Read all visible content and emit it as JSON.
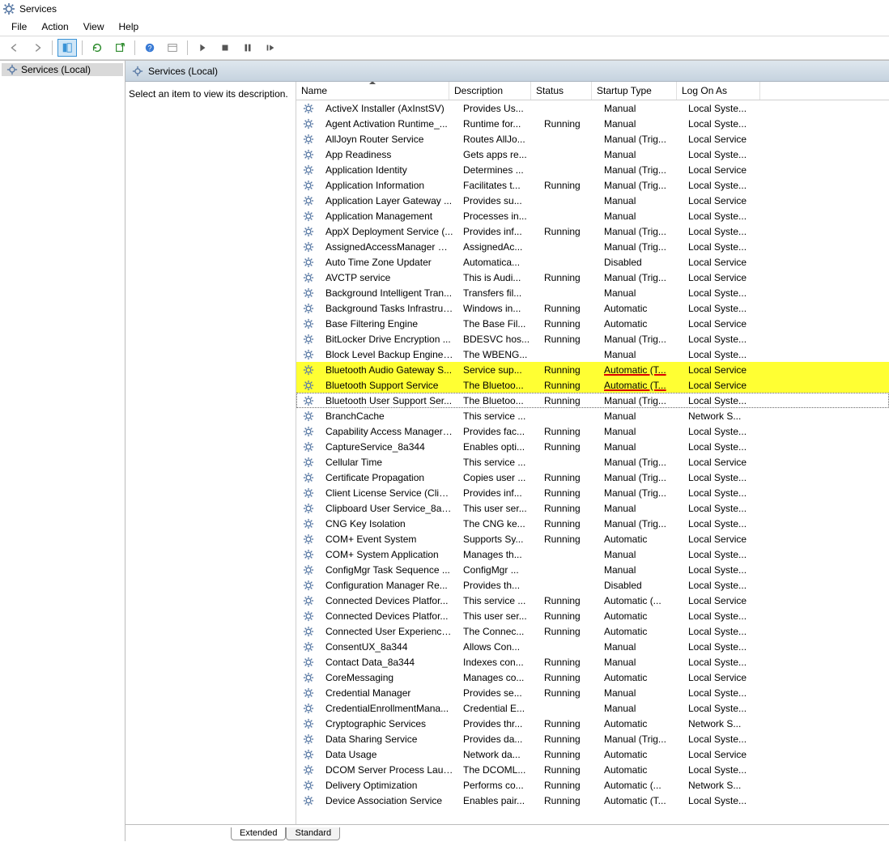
{
  "window": {
    "title": "Services"
  },
  "menubar": {
    "items": [
      "File",
      "Action",
      "View",
      "Help"
    ]
  },
  "tree": {
    "root_label": "Services (Local)"
  },
  "panel": {
    "header": "Services (Local)",
    "hint": "Select an item to view its description."
  },
  "columns": {
    "name": "Name",
    "description": "Description",
    "status": "Status",
    "startup": "Startup Type",
    "logon": "Log On As"
  },
  "tabs": {
    "extended": "Extended",
    "standard": "Standard"
  },
  "services": [
    {
      "name": "ActiveX Installer (AxInstSV)",
      "desc": "Provides Us...",
      "status": "",
      "startup": "Manual",
      "logon": "Local Syste..."
    },
    {
      "name": "Agent Activation Runtime_...",
      "desc": "Runtime for...",
      "status": "Running",
      "startup": "Manual",
      "logon": "Local Syste..."
    },
    {
      "name": "AllJoyn Router Service",
      "desc": "Routes AllJo...",
      "status": "",
      "startup": "Manual (Trig...",
      "logon": "Local Service"
    },
    {
      "name": "App Readiness",
      "desc": "Gets apps re...",
      "status": "",
      "startup": "Manual",
      "logon": "Local Syste..."
    },
    {
      "name": "Application Identity",
      "desc": "Determines ...",
      "status": "",
      "startup": "Manual (Trig...",
      "logon": "Local Service"
    },
    {
      "name": "Application Information",
      "desc": "Facilitates t...",
      "status": "Running",
      "startup": "Manual (Trig...",
      "logon": "Local Syste..."
    },
    {
      "name": "Application Layer Gateway ...",
      "desc": "Provides su...",
      "status": "",
      "startup": "Manual",
      "logon": "Local Service"
    },
    {
      "name": "Application Management",
      "desc": "Processes in...",
      "status": "",
      "startup": "Manual",
      "logon": "Local Syste..."
    },
    {
      "name": "AppX Deployment Service (...",
      "desc": "Provides inf...",
      "status": "Running",
      "startup": "Manual (Trig...",
      "logon": "Local Syste..."
    },
    {
      "name": "AssignedAccessManager Se...",
      "desc": "AssignedAc...",
      "status": "",
      "startup": "Manual (Trig...",
      "logon": "Local Syste..."
    },
    {
      "name": "Auto Time Zone Updater",
      "desc": "Automatica...",
      "status": "",
      "startup": "Disabled",
      "logon": "Local Service"
    },
    {
      "name": "AVCTP service",
      "desc": "This is Audi...",
      "status": "Running",
      "startup": "Manual (Trig...",
      "logon": "Local Service"
    },
    {
      "name": "Background Intelligent Tran...",
      "desc": "Transfers fil...",
      "status": "",
      "startup": "Manual",
      "logon": "Local Syste..."
    },
    {
      "name": "Background Tasks Infrastruc...",
      "desc": "Windows in...",
      "status": "Running",
      "startup": "Automatic",
      "logon": "Local Syste..."
    },
    {
      "name": "Base Filtering Engine",
      "desc": "The Base Fil...",
      "status": "Running",
      "startup": "Automatic",
      "logon": "Local Service"
    },
    {
      "name": "BitLocker Drive Encryption ...",
      "desc": "BDESVC hos...",
      "status": "Running",
      "startup": "Manual (Trig...",
      "logon": "Local Syste..."
    },
    {
      "name": "Block Level Backup Engine ...",
      "desc": "The WBENG...",
      "status": "",
      "startup": "Manual",
      "logon": "Local Syste..."
    },
    {
      "name": "Bluetooth Audio Gateway S...",
      "desc": "Service sup...",
      "status": "Running",
      "startup": "Automatic (T...",
      "logon": "Local Service",
      "hl": "yellow",
      "red_startup": true
    },
    {
      "name": "Bluetooth Support Service",
      "desc": "The Bluetoo...",
      "status": "Running",
      "startup": "Automatic (T...",
      "logon": "Local Service",
      "hl": "yellow",
      "red_startup": true
    },
    {
      "name": "Bluetooth User Support Ser...",
      "desc": "The Bluetoo...",
      "status": "Running",
      "startup": "Manual (Trig...",
      "logon": "Local Syste...",
      "focus": true
    },
    {
      "name": "BranchCache",
      "desc": "This service ...",
      "status": "",
      "startup": "Manual",
      "logon": "Network S..."
    },
    {
      "name": "Capability Access Manager ...",
      "desc": "Provides fac...",
      "status": "Running",
      "startup": "Manual",
      "logon": "Local Syste..."
    },
    {
      "name": "CaptureService_8a344",
      "desc": "Enables opti...",
      "status": "Running",
      "startup": "Manual",
      "logon": "Local Syste..."
    },
    {
      "name": "Cellular Time",
      "desc": "This service ...",
      "status": "",
      "startup": "Manual (Trig...",
      "logon": "Local Service"
    },
    {
      "name": "Certificate Propagation",
      "desc": "Copies user ...",
      "status": "Running",
      "startup": "Manual (Trig...",
      "logon": "Local Syste..."
    },
    {
      "name": "Client License Service (ClipS...",
      "desc": "Provides inf...",
      "status": "Running",
      "startup": "Manual (Trig...",
      "logon": "Local Syste..."
    },
    {
      "name": "Clipboard User Service_8a344",
      "desc": "This user ser...",
      "status": "Running",
      "startup": "Manual",
      "logon": "Local Syste..."
    },
    {
      "name": "CNG Key Isolation",
      "desc": "The CNG ke...",
      "status": "Running",
      "startup": "Manual (Trig...",
      "logon": "Local Syste..."
    },
    {
      "name": "COM+ Event System",
      "desc": "Supports Sy...",
      "status": "Running",
      "startup": "Automatic",
      "logon": "Local Service"
    },
    {
      "name": "COM+ System Application",
      "desc": "Manages th...",
      "status": "",
      "startup": "Manual",
      "logon": "Local Syste..."
    },
    {
      "name": "ConfigMgr Task Sequence ...",
      "desc": "ConfigMgr ...",
      "status": "",
      "startup": "Manual",
      "logon": "Local Syste..."
    },
    {
      "name": "Configuration Manager Re...",
      "desc": "Provides th...",
      "status": "",
      "startup": "Disabled",
      "logon": "Local Syste..."
    },
    {
      "name": "Connected Devices Platfor...",
      "desc": "This service ...",
      "status": "Running",
      "startup": "Automatic (...",
      "logon": "Local Service"
    },
    {
      "name": "Connected Devices Platfor...",
      "desc": "This user ser...",
      "status": "Running",
      "startup": "Automatic",
      "logon": "Local Syste..."
    },
    {
      "name": "Connected User Experience...",
      "desc": "The Connec...",
      "status": "Running",
      "startup": "Automatic",
      "logon": "Local Syste..."
    },
    {
      "name": "ConsentUX_8a344",
      "desc": "Allows Con...",
      "status": "",
      "startup": "Manual",
      "logon": "Local Syste..."
    },
    {
      "name": "Contact Data_8a344",
      "desc": "Indexes con...",
      "status": "Running",
      "startup": "Manual",
      "logon": "Local Syste..."
    },
    {
      "name": "CoreMessaging",
      "desc": "Manages co...",
      "status": "Running",
      "startup": "Automatic",
      "logon": "Local Service"
    },
    {
      "name": "Credential Manager",
      "desc": "Provides se...",
      "status": "Running",
      "startup": "Manual",
      "logon": "Local Syste..."
    },
    {
      "name": "CredentialEnrollmentMana...",
      "desc": "Credential E...",
      "status": "",
      "startup": "Manual",
      "logon": "Local Syste..."
    },
    {
      "name": "Cryptographic Services",
      "desc": "Provides thr...",
      "status": "Running",
      "startup": "Automatic",
      "logon": "Network S..."
    },
    {
      "name": "Data Sharing Service",
      "desc": "Provides da...",
      "status": "Running",
      "startup": "Manual (Trig...",
      "logon": "Local Syste..."
    },
    {
      "name": "Data Usage",
      "desc": "Network da...",
      "status": "Running",
      "startup": "Automatic",
      "logon": "Local Service"
    },
    {
      "name": "DCOM Server Process Laun...",
      "desc": "The DCOML...",
      "status": "Running",
      "startup": "Automatic",
      "logon": "Local Syste..."
    },
    {
      "name": "Delivery Optimization",
      "desc": "Performs co...",
      "status": "Running",
      "startup": "Automatic (...",
      "logon": "Network S..."
    },
    {
      "name": "Device Association Service",
      "desc": "Enables pair...",
      "status": "Running",
      "startup": "Automatic (T...",
      "logon": "Local Syste..."
    }
  ]
}
